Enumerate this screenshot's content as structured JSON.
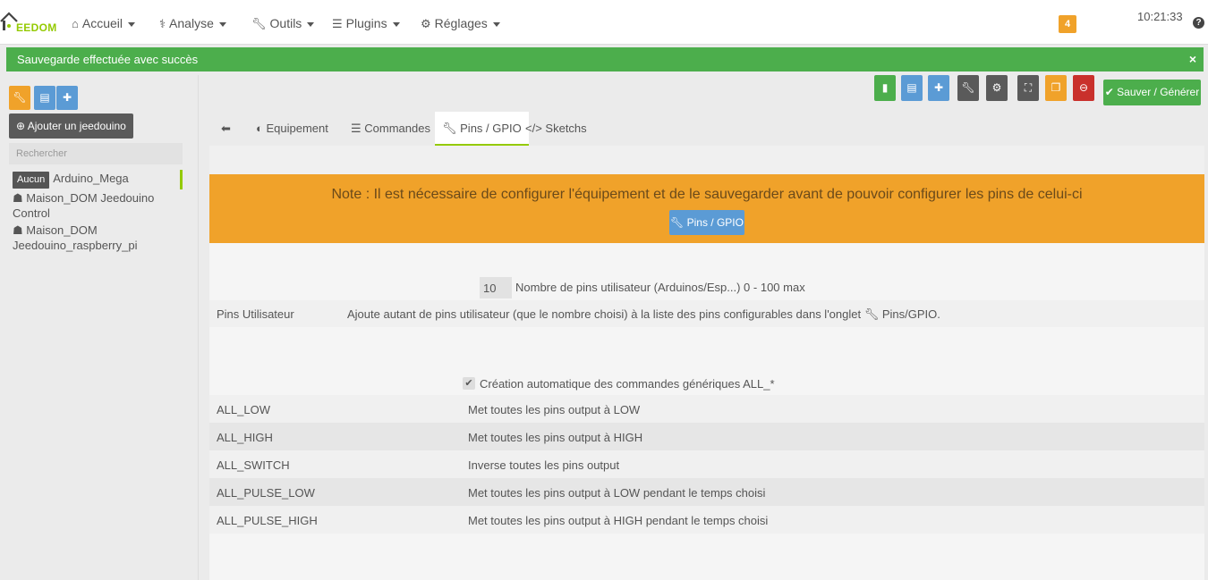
{
  "navbar": {
    "brand": "EEDOM",
    "items": [
      {
        "label": "Accueil",
        "icon": "home-icon"
      },
      {
        "label": "Analyse",
        "icon": "stethoscope-icon"
      },
      {
        "label": "Outils",
        "icon": "wrench-icon"
      },
      {
        "label": "Plugins",
        "icon": "list-icon"
      },
      {
        "label": "Réglages",
        "icon": "gear-icon"
      }
    ],
    "notifications": "4",
    "clock": "10:21:33",
    "help": "?"
  },
  "alert": {
    "text": "Sauvegarde effectuée avec succès",
    "close": "×"
  },
  "sidebar": {
    "add_label": "Ajouter un jeedouino",
    "search_placeholder": "Rechercher",
    "equipments": [
      {
        "tag": "Aucun",
        "name": "Arduino_Mega"
      },
      {
        "name": "Maison_DOM Jeedouino Control"
      },
      {
        "name": "Maison_DOM Jeedouino_raspberry_pi"
      }
    ]
  },
  "toolbar": {
    "save_label": "Sauver / Générer"
  },
  "tabs": [
    {
      "label": ""
    },
    {
      "label": "Equipement"
    },
    {
      "label": "Commandes"
    },
    {
      "label": "Pins / GPIO"
    },
    {
      "label": "Sketchs"
    }
  ],
  "note": {
    "text": "Note : Il est nécessaire de configurer l'équipement et de le sauvegarder avant de pouvoir configurer les pins de celui-ci",
    "button": "Pins / GPIO"
  },
  "pins": {
    "value": "10",
    "label": "Nombre de pins utilisateur (Arduinos/Esp...) 0 - 100 max"
  },
  "user_pins": {
    "key": "Pins Utilisateur",
    "desc": "Ajoute autant de pins utilisateur (que le nombre choisi) à la liste des pins configurables dans l'onglet",
    "tab_ref": "Pins/GPIO."
  },
  "generic": {
    "label": "Création automatique des commandes génériques ALL_*",
    "checked": true
  },
  "commands": [
    {
      "name": "ALL_LOW",
      "desc": "Met toutes les pins output à LOW"
    },
    {
      "name": "ALL_HIGH",
      "desc": "Met toutes les pins output à HIGH"
    },
    {
      "name": "ALL_SWITCH",
      "desc": "Inverse toutes les pins output"
    },
    {
      "name": "ALL_PULSE_LOW",
      "desc": "Met toutes les pins output à LOW pendant le temps choisi"
    },
    {
      "name": "ALL_PULSE_HIGH",
      "desc": "Met toutes les pins output à HIGH pendant le temps choisi"
    }
  ],
  "colors": {
    "accent_green": "#94ca02",
    "success": "#4cae4c",
    "warning": "#f0a22a",
    "info": "#5b9bd5",
    "danger": "#c9302c",
    "dark": "#5a5a5a"
  }
}
